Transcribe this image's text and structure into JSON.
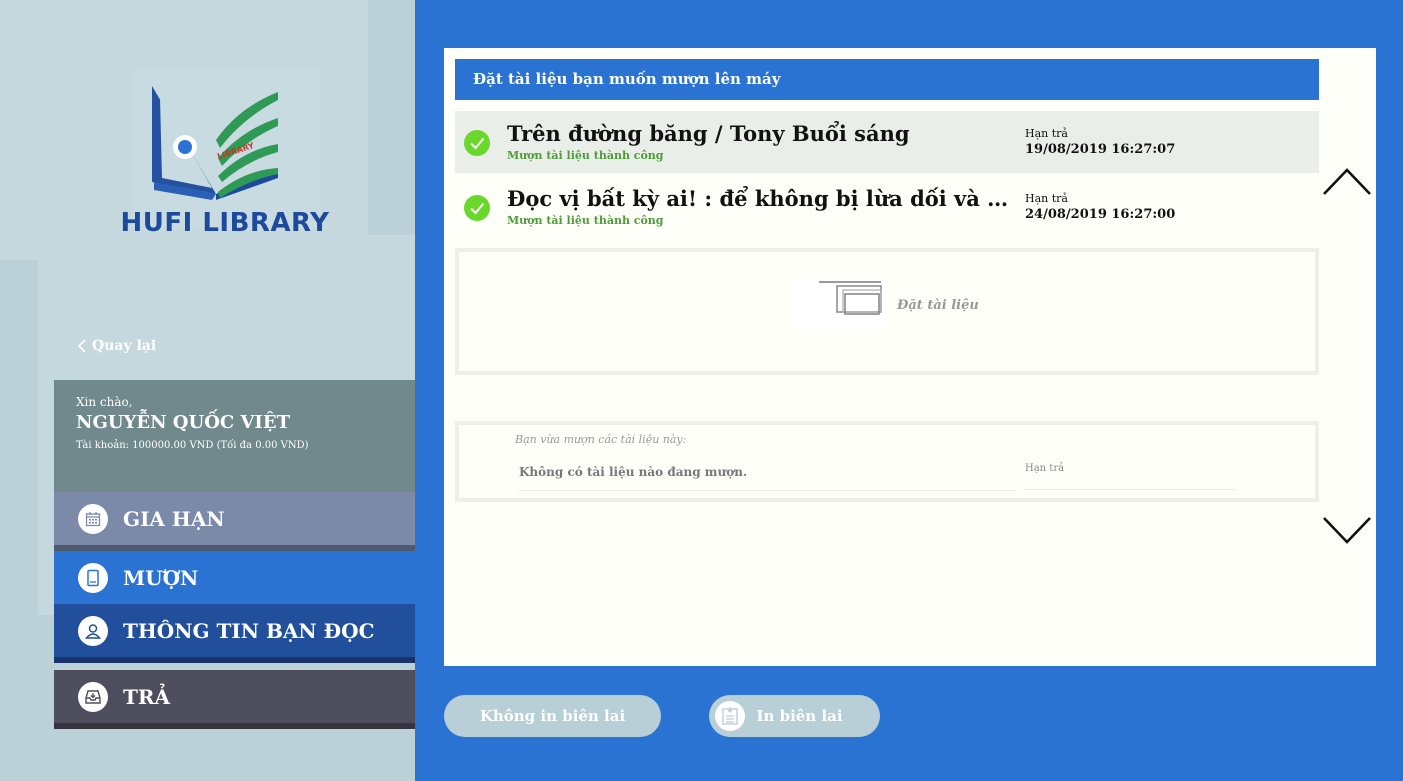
{
  "brand": {
    "name": "HUFI LIBRARY",
    "logo_text": "LIBRARY"
  },
  "sidebar": {
    "back_label": "Quay lại",
    "greeting": "Xin chào,",
    "user_name": "NGUYỄN QUỐC VIỆT",
    "balance": "Tài khoản: 100000.00 VND (Tối đa 0.00 VND)",
    "menu": [
      {
        "label": "GIA HẠN",
        "icon": "calendar-icon"
      },
      {
        "label": "MƯỢN",
        "icon": "book-icon",
        "active": true
      },
      {
        "label": "THÔNG TIN BẠN ĐỌC",
        "icon": "user-icon"
      },
      {
        "label": "TRẢ",
        "icon": "return-tray-icon"
      }
    ]
  },
  "main": {
    "header": "Đặt tài liệu bạn muốn mượn lên máy",
    "items": [
      {
        "title": "Trên đường băng / Tony Buổi sáng",
        "status": "Mượn tài liệu thành công",
        "due_label": "Hạn trả",
        "due_date": "19/08/2019 16:27:07"
      },
      {
        "title": "Đọc vị bất kỳ ai! : để không bị lừa dối và lợi dụng / David J. Lieberman",
        "status": "Mượn tài liệu thành công",
        "due_label": "Hạn trả",
        "due_date": "24/08/2019 16:27:00"
      }
    ],
    "dropzone_label": "Đặt tài liệu",
    "borrowed": {
      "heading": "Bạn vừa mượn các tài liệu này:",
      "empty_text": "Không có tài liệu nào đang mượn.",
      "due_header": "Hạn trả"
    }
  },
  "buttons": {
    "no_receipt": "Không in biên lai",
    "print_receipt": "In biên lai"
  },
  "colors": {
    "primary": "#2b73d2",
    "success": "#4e9d3a",
    "check": "#6ad82a",
    "logo_blue": "#1d4a9c"
  }
}
